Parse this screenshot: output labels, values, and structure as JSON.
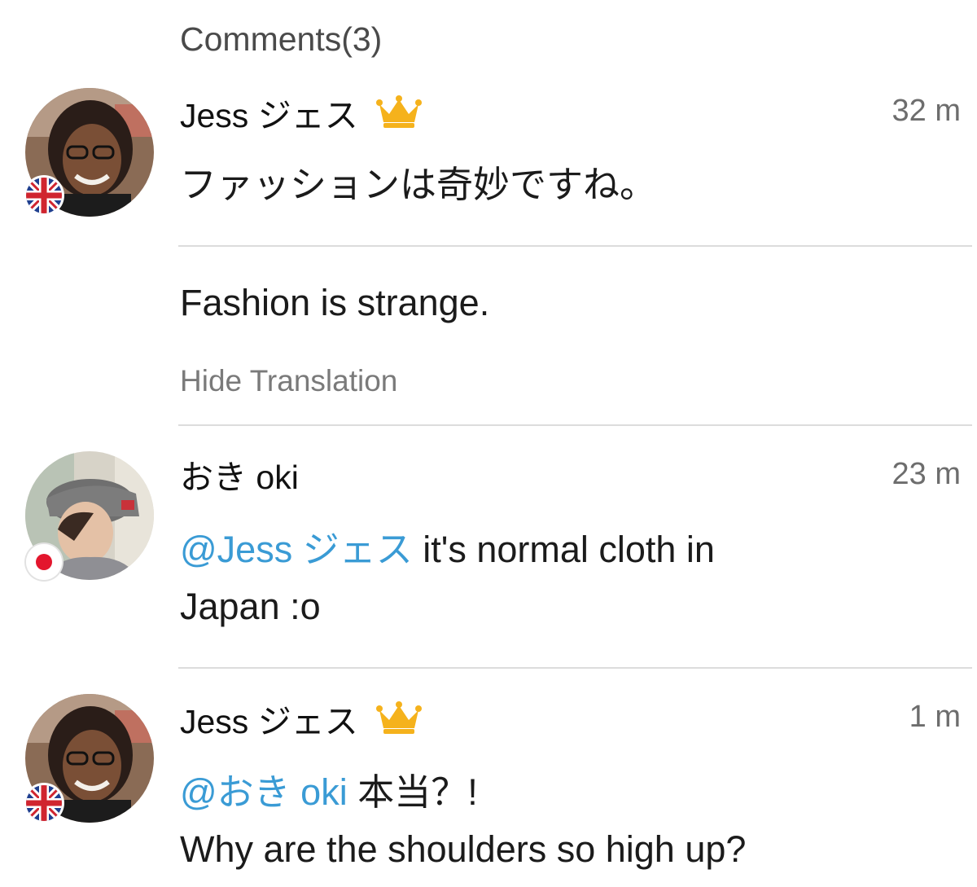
{
  "comments_header": "Comments(3)",
  "comments": [
    {
      "username": "Jess ジェス",
      "has_crown": true,
      "flag": "uk-flag",
      "time": "32 m",
      "text": "ファッションは奇妙ですね。",
      "translation": "Fashion is strange.",
      "hide_translation_label": "Hide Translation"
    },
    {
      "username": "おき oki",
      "has_crown": false,
      "flag": "japan-flag",
      "time": "23 m",
      "mention": "@Jess ジェス",
      "text": "it's normal cloth in",
      "text_line2": "Japan :o"
    },
    {
      "username": "Jess ジェス",
      "has_crown": true,
      "flag": "uk-flag",
      "time": "1 m",
      "mention": "@おき oki",
      "text": "本当？!",
      "text_line2": "Why are the shoulders so high up?"
    }
  ],
  "colors": {
    "mention": "#3a9bd5",
    "crown": "#f5b21c",
    "divider": "#dcdcdc",
    "timestamp": "#6d6d6d"
  }
}
